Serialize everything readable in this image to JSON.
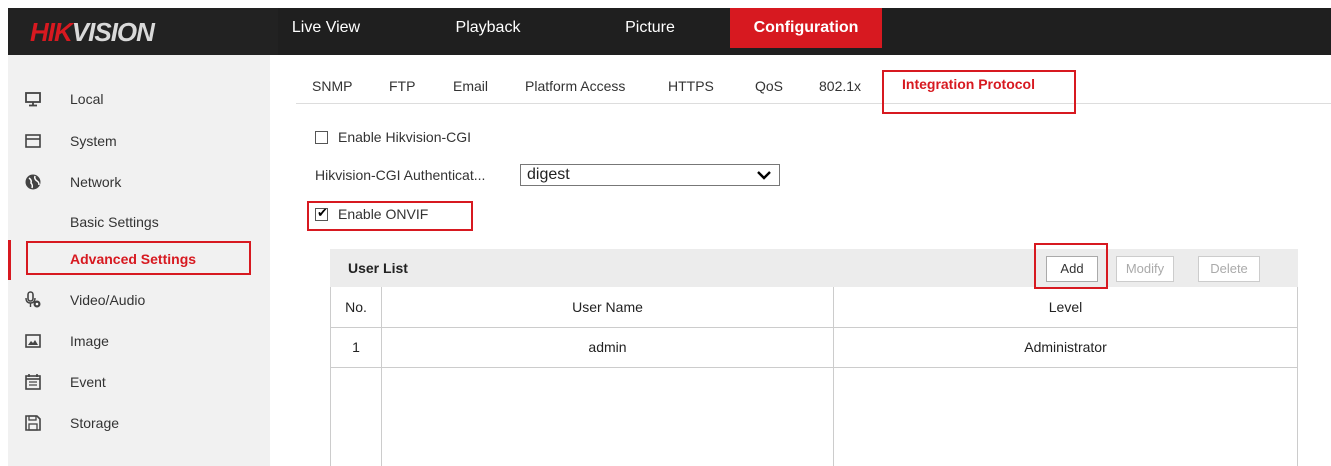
{
  "brand": {
    "part1": "HIK",
    "part2": "VISION"
  },
  "topnav": [
    {
      "label": "Live View",
      "active": false
    },
    {
      "label": "Playback",
      "active": false
    },
    {
      "label": "Picture",
      "active": false
    },
    {
      "label": "Configuration",
      "active": true
    }
  ],
  "sidebar": {
    "items": [
      {
        "label": "Local",
        "icon": "monitor-icon"
      },
      {
        "label": "System",
        "icon": "window-icon"
      },
      {
        "label": "Network",
        "icon": "globe-icon"
      },
      {
        "label": "Video/Audio",
        "icon": "microphone-video-icon"
      },
      {
        "label": "Image",
        "icon": "image-icon"
      },
      {
        "label": "Event",
        "icon": "calendar-icon"
      },
      {
        "label": "Storage",
        "icon": "floppy-disk-icon"
      }
    ],
    "network_sub": [
      {
        "label": "Basic Settings",
        "active": false
      },
      {
        "label": "Advanced Settings",
        "active": true
      }
    ]
  },
  "tabs": [
    {
      "label": "SNMP"
    },
    {
      "label": "FTP"
    },
    {
      "label": "Email"
    },
    {
      "label": "Platform Access"
    },
    {
      "label": "HTTPS"
    },
    {
      "label": "QoS"
    },
    {
      "label": "802.1x"
    },
    {
      "label": "Integration Protocol",
      "active": true
    }
  ],
  "form": {
    "enable_cgi_label": "Enable Hikvision-CGI",
    "enable_cgi_checked": false,
    "cgi_auth_label": "Hikvision-CGI Authenticat...",
    "cgi_auth_value": "digest",
    "enable_onvif_label": "Enable ONVIF",
    "enable_onvif_checked": true
  },
  "user_list": {
    "title": "User List",
    "buttons": {
      "add": "Add",
      "modify": "Modify",
      "delete": "Delete"
    },
    "columns": [
      "No.",
      "User Name",
      "Level"
    ],
    "rows": [
      {
        "no": "1",
        "user_name": "admin",
        "level": "Administrator"
      }
    ]
  },
  "colors": {
    "accent": "#d71920",
    "topbar": "#1f1f1f",
    "sidebar": "#f1f1f1"
  }
}
